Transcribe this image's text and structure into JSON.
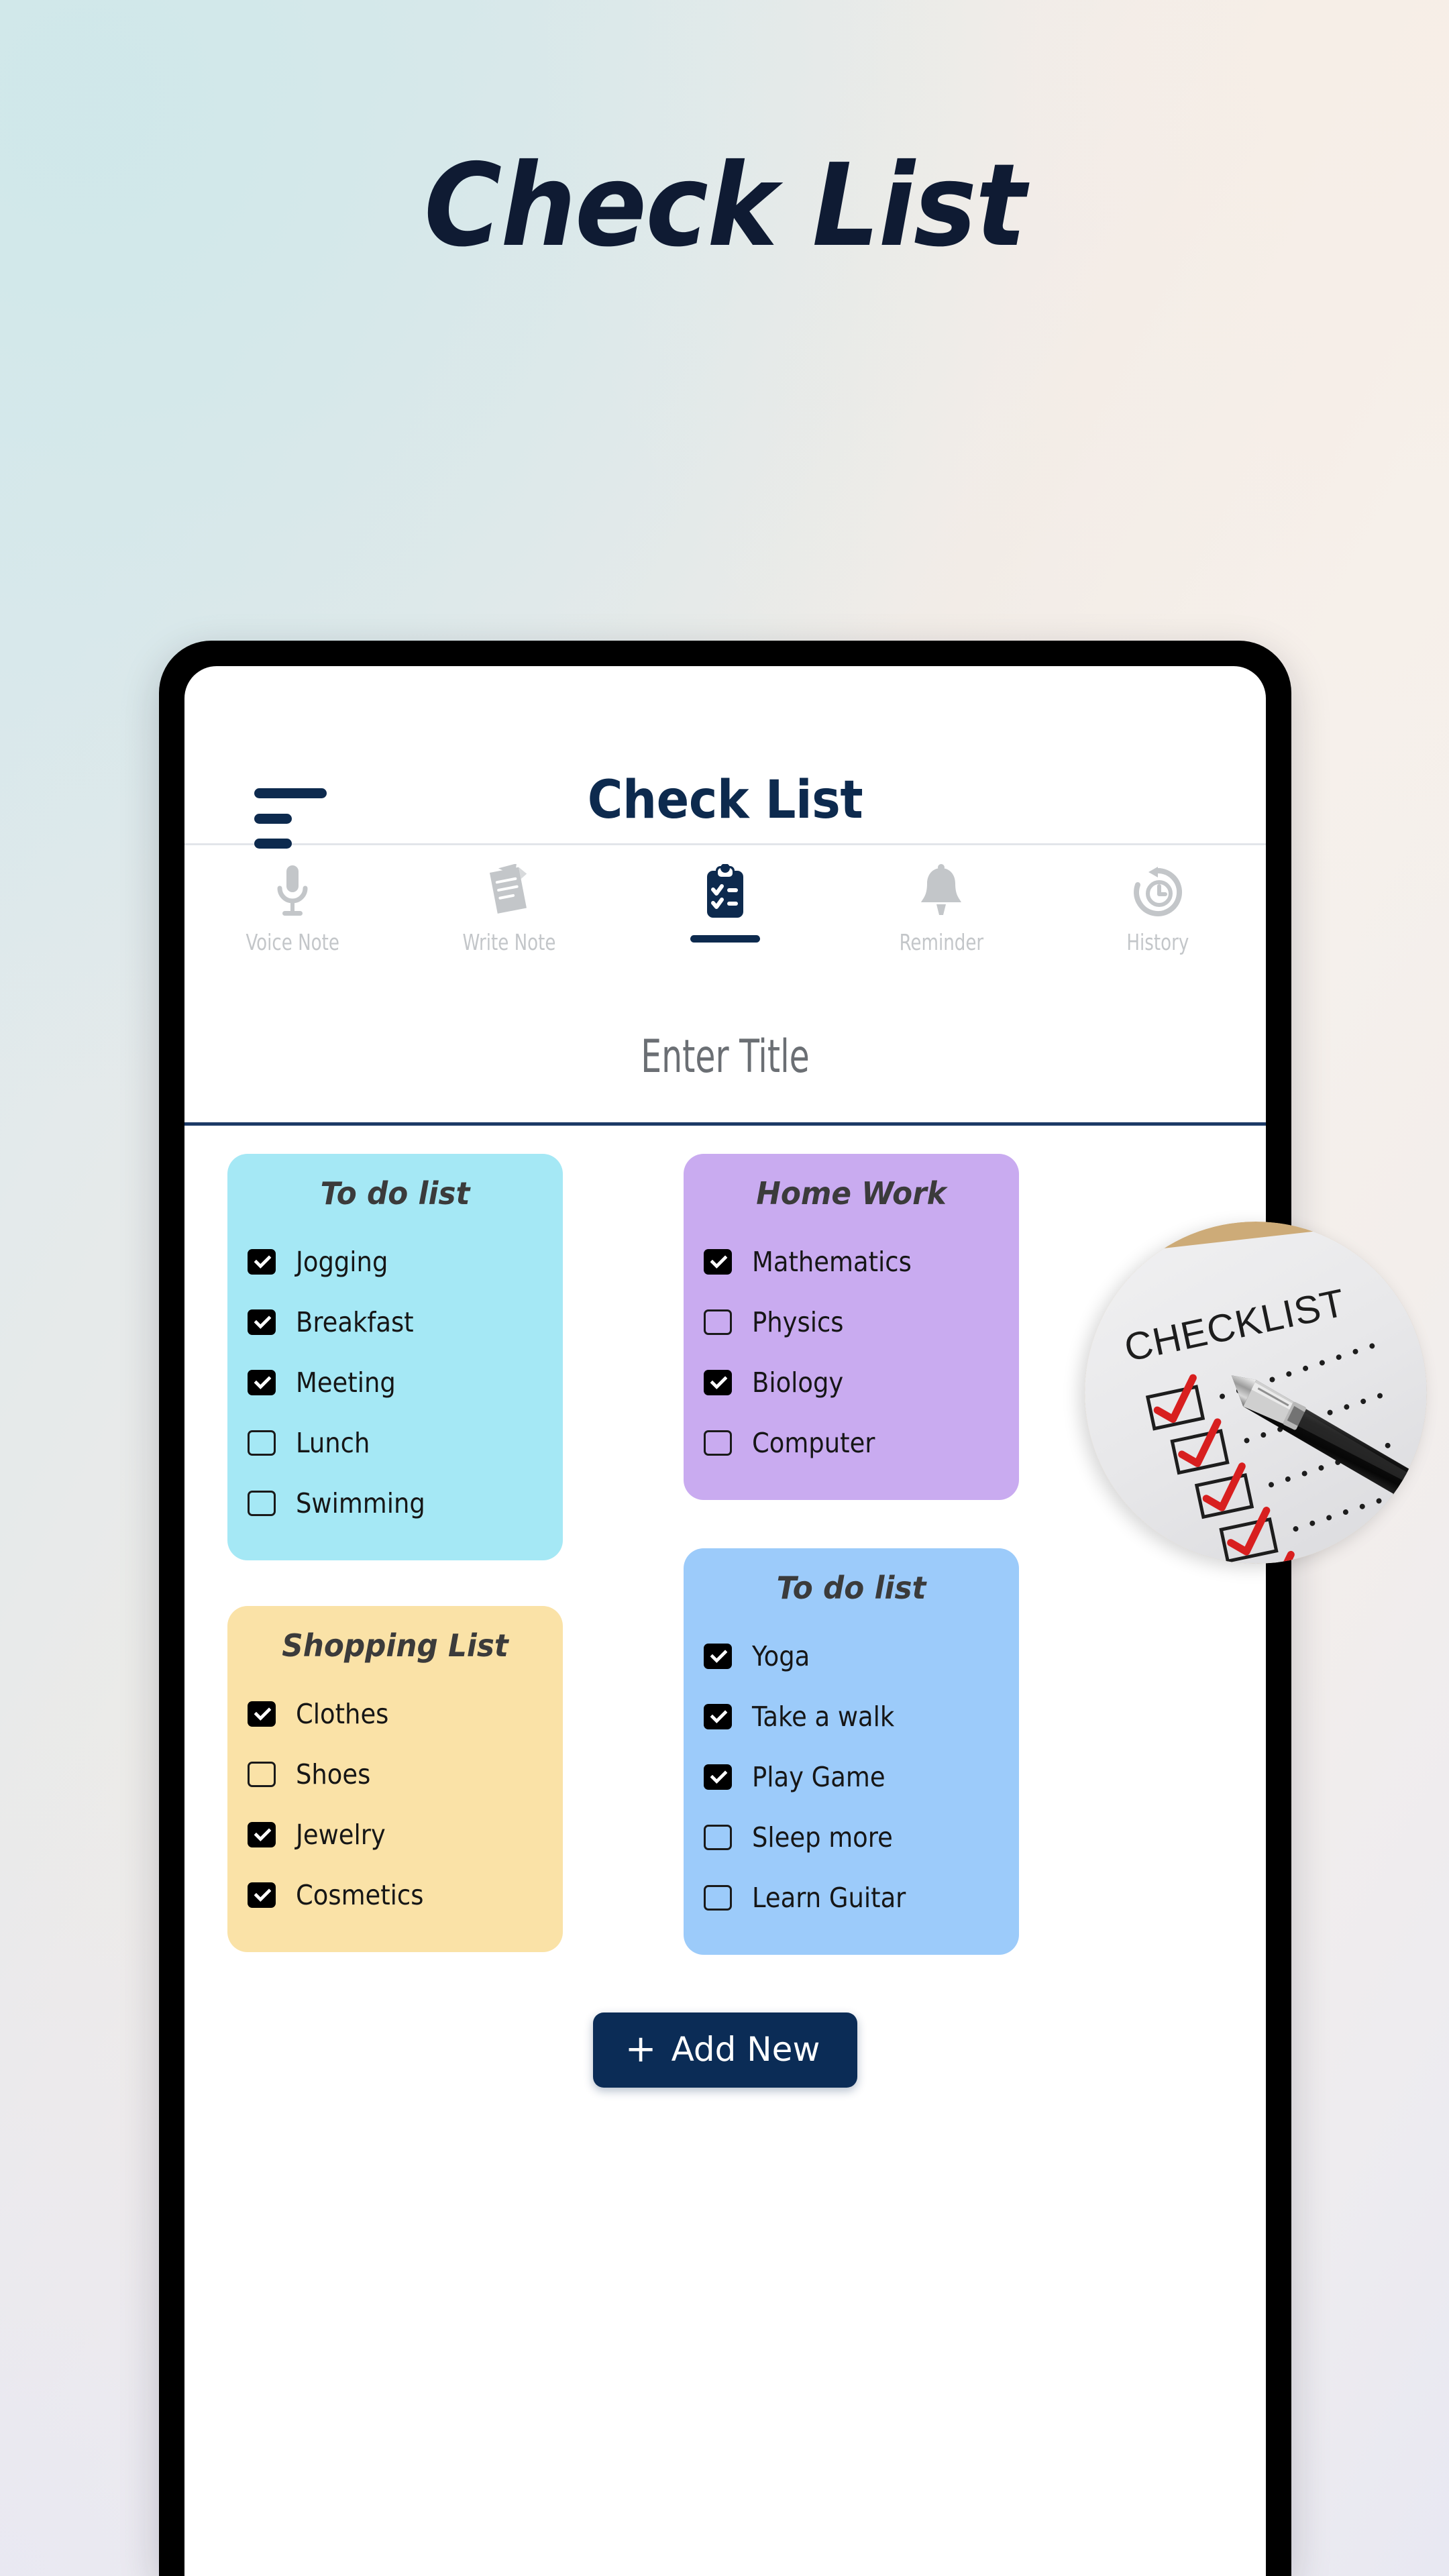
{
  "hero": {
    "title": "Check List"
  },
  "phone": {
    "appbar": {
      "menu_icon": "hamburger-menu-icon",
      "title": "Check List"
    },
    "tabs": [
      {
        "label": "Voice Note",
        "icon": "microphone-icon",
        "active": false
      },
      {
        "label": "Write Note",
        "icon": "note-pencil-icon",
        "active": false
      },
      {
        "label": "",
        "icon": "clipboard-checklist-icon",
        "active": true
      },
      {
        "label": "Reminder",
        "icon": "bell-icon",
        "active": false
      },
      {
        "label": "History",
        "icon": "clock-history-icon",
        "active": false
      }
    ],
    "title_input": {
      "placeholder": "Enter Title",
      "value": ""
    },
    "cards": [
      {
        "title": "To do list",
        "color": "#a5e8f5",
        "items": [
          {
            "label": "Jogging",
            "checked": true
          },
          {
            "label": "Breakfast",
            "checked": true
          },
          {
            "label": "Meeting",
            "checked": true
          },
          {
            "label": "Lunch",
            "checked": false
          },
          {
            "label": "Swimming",
            "checked": false
          }
        ]
      },
      {
        "title": "Home Work",
        "color": "#c9abf0",
        "items": [
          {
            "label": "Mathematics",
            "checked": true
          },
          {
            "label": "Physics",
            "checked": false
          },
          {
            "label": "Biology",
            "checked": true
          },
          {
            "label": "Computer",
            "checked": false
          }
        ]
      },
      {
        "title": "Shopping List",
        "color": "#fae2a7",
        "items": [
          {
            "label": "Clothes",
            "checked": true
          },
          {
            "label": "Shoes",
            "checked": false
          },
          {
            "label": "Jewelry",
            "checked": true
          },
          {
            "label": "Cosmetics",
            "checked": true
          }
        ]
      },
      {
        "title": "To do list",
        "color": "#9ccbfa",
        "items": [
          {
            "label": "Yoga",
            "checked": true
          },
          {
            "label": "Take a walk",
            "checked": true
          },
          {
            "label": "Play Game",
            "checked": true
          },
          {
            "label": "Sleep more",
            "checked": false
          },
          {
            "label": "Learn Guitar",
            "checked": false
          }
        ]
      }
    ],
    "add_new": {
      "plus": "+",
      "label": "Add New"
    }
  },
  "photo_overlay": {
    "name": "checklist-photo",
    "caption": "CHECKLIST",
    "check_marks": 5,
    "check_color": "#d81f1f"
  },
  "colors": {
    "accent_navy": "#0d2a4e",
    "button_navy": "#0b2c56",
    "hero_navy": "#0f1b33",
    "tab_inactive": "#c3c6c9"
  }
}
